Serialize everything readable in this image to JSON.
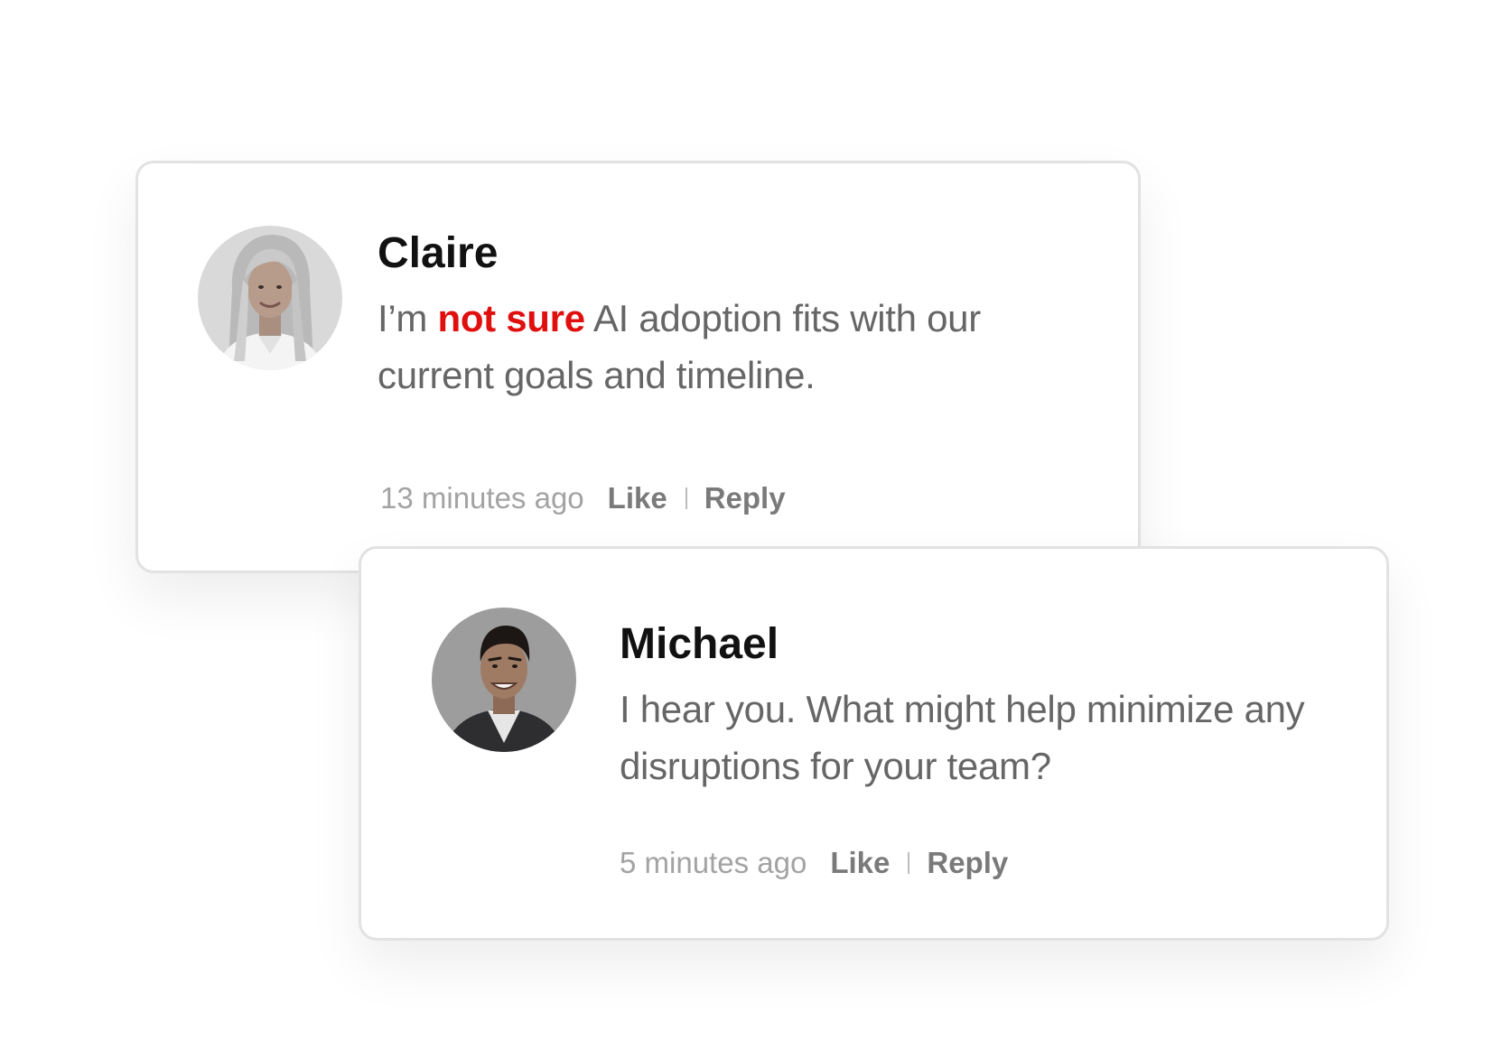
{
  "comments": [
    {
      "author": "Claire",
      "avatar_icon": "avatar-woman-gray-hair",
      "message_before": "I’m ",
      "message_highlight": "not sure",
      "message_after": " AI adoption fits with our current goals and timeline.",
      "time": "13 minutes ago",
      "like_label": "Like",
      "reply_label": "Reply"
    },
    {
      "author": "Michael",
      "avatar_icon": "avatar-man-dark-hair",
      "message": "I hear you. What might help minimize any disruptions for your team?",
      "time": "5 minutes ago",
      "like_label": "Like",
      "reply_label": "Reply"
    }
  ],
  "colors": {
    "highlight": "#e0100f",
    "name": "#111111",
    "message": "#666666",
    "time": "#a3a3a3",
    "action": "#7a7a7a",
    "card_border": "#e2e2e2"
  }
}
